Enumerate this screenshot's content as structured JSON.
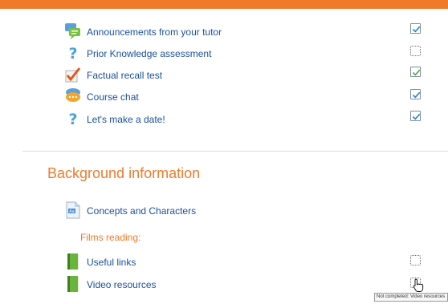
{
  "colors": {
    "accent": "#f07a2a",
    "link": "#1a4f9c",
    "check": "#2e7fd0"
  },
  "activities": [
    {
      "label": "Announcements from your tutor",
      "icon": "forum-icon",
      "completion": "complete"
    },
    {
      "label": "Prior Knowledge assessment",
      "icon": "question-icon",
      "completion": "incomplete"
    },
    {
      "label": "Factual recall test",
      "icon": "quiz-check-icon",
      "completion": "complete"
    },
    {
      "label": "Course chat",
      "icon": "chat-icon",
      "completion": "complete"
    },
    {
      "label": "Let's make a date!",
      "icon": "question-icon",
      "completion": "complete"
    }
  ],
  "section": {
    "title": "Background information",
    "page_item": {
      "label": "Concepts and Characters",
      "icon": "page-icon"
    },
    "subheading": "Films reading:",
    "books": [
      {
        "label": "Useful links",
        "icon": "book-icon",
        "completion": "incomplete"
      },
      {
        "label": "Video resources",
        "icon": "book-icon",
        "completion": "incomplete"
      }
    ]
  },
  "tooltip": "Not completed: Video resources"
}
